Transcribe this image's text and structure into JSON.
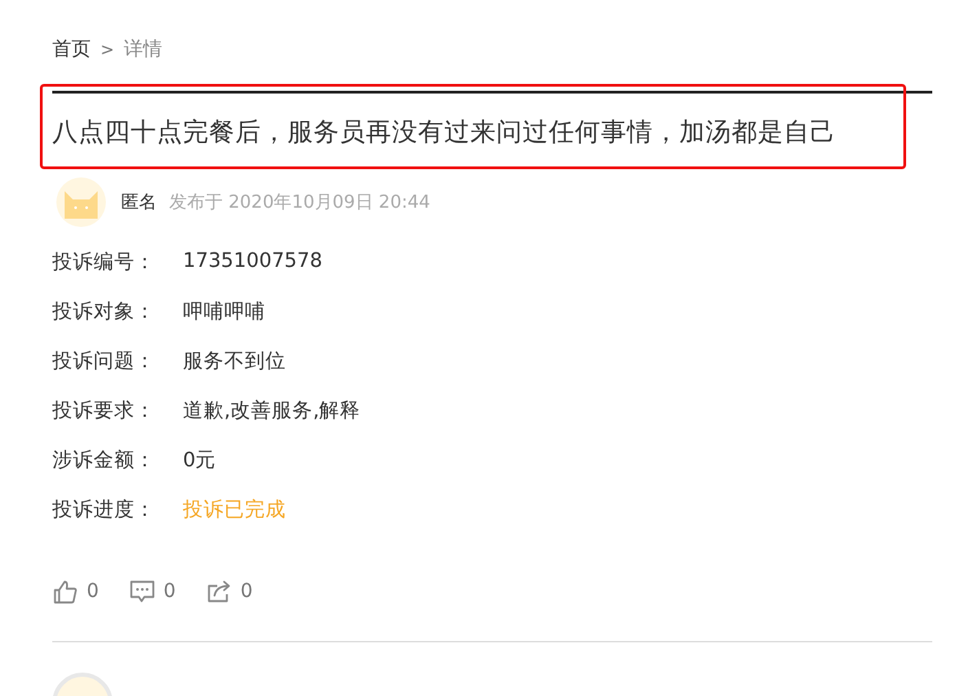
{
  "breadcrumb": [
    {
      "label": "首页"
    },
    {
      "label": "详情"
    }
  ],
  "breadcrumb_separator": ">",
  "title": "八点四十点完餐后，服务员再没有过来问过任何事情，加汤都是自己",
  "title_highlighted": true,
  "author": {
    "name": "匿名",
    "posted": "发布于 2020年10月09日 20:44"
  },
  "fields": [
    {
      "label": "投诉编号：",
      "value": "17351007578",
      "kind": "text"
    },
    {
      "label": "投诉对象：",
      "value": "呷哺呷哺",
      "kind": "text"
    },
    {
      "label": "投诉问题：",
      "value": "服务不到位",
      "kind": "text"
    },
    {
      "label": "投诉要求：",
      "value": "道歉,改善服务,解释",
      "kind": "text"
    },
    {
      "label": "涉诉金额：",
      "value": "0元",
      "kind": "text"
    },
    {
      "label": "投诉进度：",
      "value": "投诉已完成",
      "kind": "status"
    }
  ],
  "actions": [
    {
      "kind": "like",
      "count": "0"
    },
    {
      "kind": "comment",
      "count": "0"
    },
    {
      "kind": "share",
      "count": "0"
    }
  ]
}
